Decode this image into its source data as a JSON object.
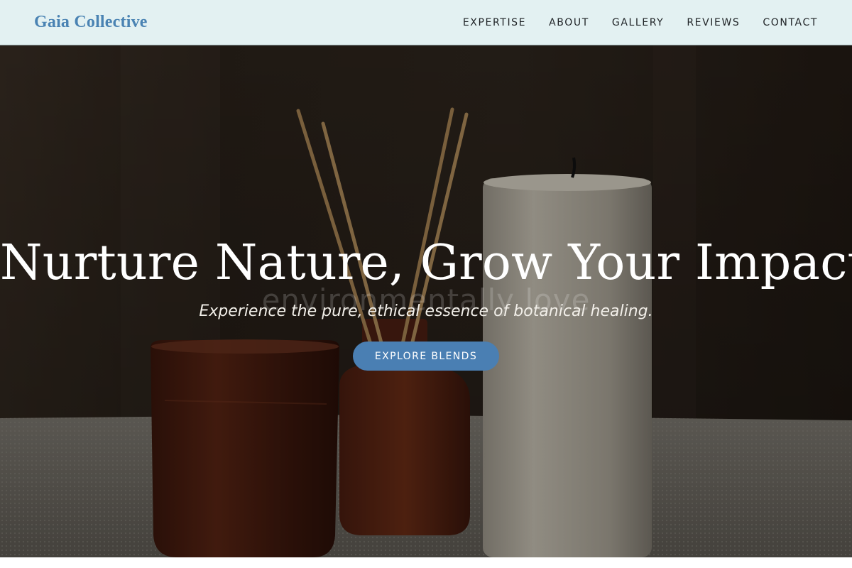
{
  "brand": {
    "name": "Gaia Collective"
  },
  "nav": {
    "items": [
      {
        "label": "EXPERTISE"
      },
      {
        "label": "ABOUT"
      },
      {
        "label": "GALLERY"
      },
      {
        "label": "REVIEWS"
      },
      {
        "label": "CONTACT"
      }
    ]
  },
  "hero": {
    "headline": "Nurture Nature, Grow Your Impact.",
    "background_text": "environmentally love",
    "tagline": "Experience the pure, ethical essence of botanical healing.",
    "cta_label": "EXPLORE BLENDS"
  },
  "colors": {
    "nav_background": "#e3f1f2",
    "brand": "#4a83b3",
    "nav_text": "#1f2326",
    "cta_background": "#4a7fb3",
    "cta_text": "#ffffff",
    "hero_text": "#ffffff"
  }
}
